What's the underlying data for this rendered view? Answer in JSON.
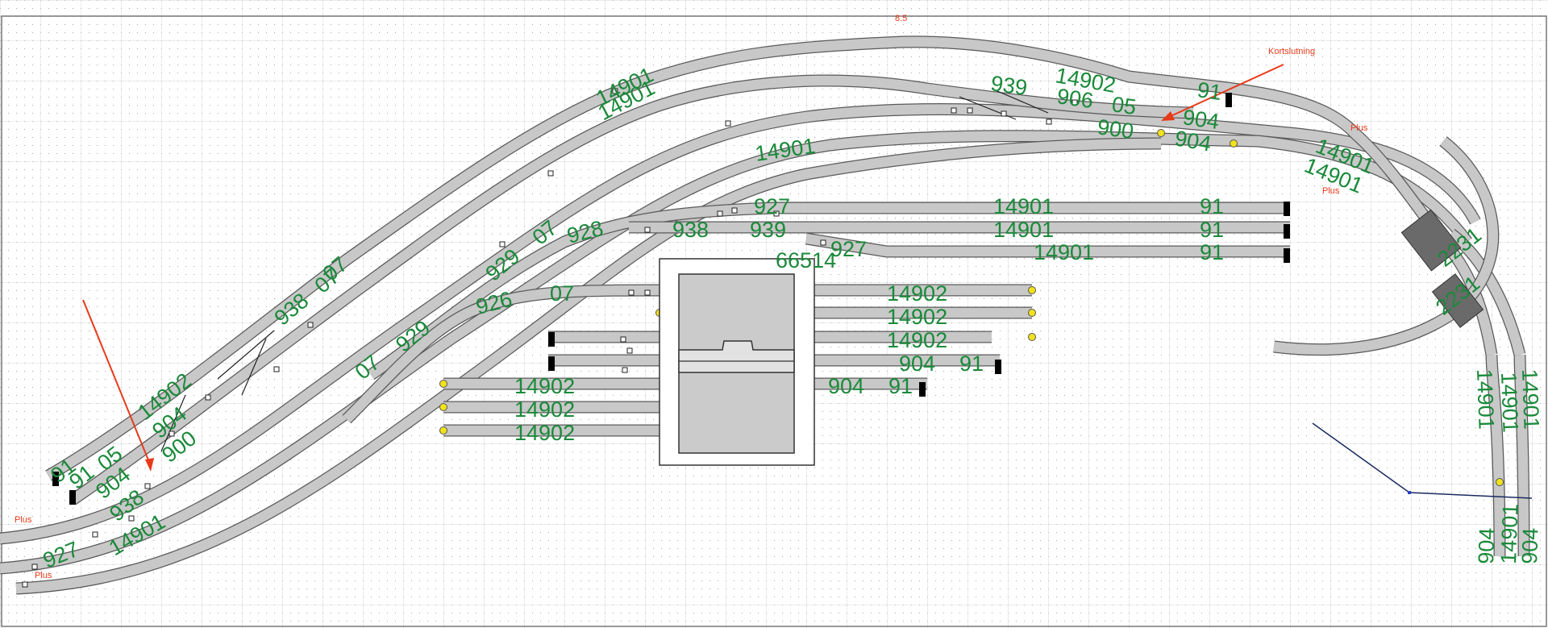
{
  "diagram": {
    "top_label": "8.5",
    "annotations": [
      "Kortslutning",
      "Plus",
      "Plus",
      "Plus",
      "Plus"
    ],
    "track_labels": {
      "upper_yard": [
        "14902",
        "939",
        "906",
        "05",
        "91",
        "904",
        "900",
        "904",
        "14901",
        "14901",
        "14901"
      ],
      "middle_yard": [
        "14901",
        "927",
        "14901",
        "91",
        "939",
        "14901",
        "91",
        "938",
        "927",
        "14901",
        "91",
        "66514",
        "928",
        "07",
        "929",
        "07"
      ],
      "turntable_yard": [
        "14902",
        "14902",
        "14902",
        "904",
        "91",
        "14902",
        "14902",
        "14902",
        "904",
        "91",
        "07",
        "926",
        "929",
        "07"
      ],
      "left_side": [
        "938",
        "07",
        "14902",
        "904",
        "900",
        "91",
        "05",
        "904",
        "938",
        "927",
        "14901",
        "91",
        "14901"
      ],
      "right_side": [
        "14901",
        "14901",
        "2231",
        "2231",
        "14901",
        "14901",
        "904",
        "904"
      ]
    },
    "colors": {
      "label": "#1a8a3a",
      "annotation": "#e83a1a",
      "track_edge": "#5a5a5a",
      "track_fill": "#c8c8c8",
      "grid": "#9a9a9a",
      "lamp": "#f2e21a"
    }
  }
}
